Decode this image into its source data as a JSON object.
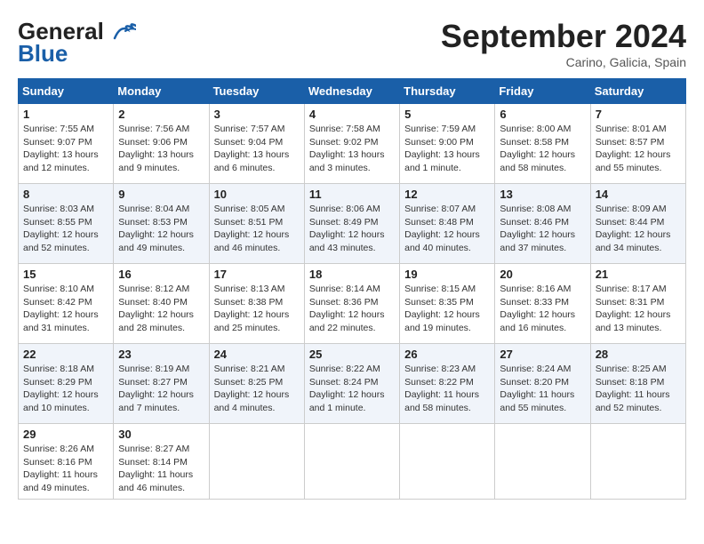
{
  "logo": {
    "line1": "General",
    "line2": "Blue"
  },
  "title": "September 2024",
  "subtitle": "Carino, Galicia, Spain",
  "headers": [
    "Sunday",
    "Monday",
    "Tuesday",
    "Wednesday",
    "Thursday",
    "Friday",
    "Saturday"
  ],
  "weeks": [
    [
      {
        "day": "1",
        "sunrise": "7:55 AM",
        "sunset": "9:07 PM",
        "daylight": "13 hours and 12 minutes."
      },
      {
        "day": "2",
        "sunrise": "7:56 AM",
        "sunset": "9:06 PM",
        "daylight": "13 hours and 9 minutes."
      },
      {
        "day": "3",
        "sunrise": "7:57 AM",
        "sunset": "9:04 PM",
        "daylight": "13 hours and 6 minutes."
      },
      {
        "day": "4",
        "sunrise": "7:58 AM",
        "sunset": "9:02 PM",
        "daylight": "13 hours and 3 minutes."
      },
      {
        "day": "5",
        "sunrise": "7:59 AM",
        "sunset": "9:00 PM",
        "daylight": "13 hours and 1 minute."
      },
      {
        "day": "6",
        "sunrise": "8:00 AM",
        "sunset": "8:58 PM",
        "daylight": "12 hours and 58 minutes."
      },
      {
        "day": "7",
        "sunrise": "8:01 AM",
        "sunset": "8:57 PM",
        "daylight": "12 hours and 55 minutes."
      }
    ],
    [
      {
        "day": "8",
        "sunrise": "8:03 AM",
        "sunset": "8:55 PM",
        "daylight": "12 hours and 52 minutes."
      },
      {
        "day": "9",
        "sunrise": "8:04 AM",
        "sunset": "8:53 PM",
        "daylight": "12 hours and 49 minutes."
      },
      {
        "day": "10",
        "sunrise": "8:05 AM",
        "sunset": "8:51 PM",
        "daylight": "12 hours and 46 minutes."
      },
      {
        "day": "11",
        "sunrise": "8:06 AM",
        "sunset": "8:49 PM",
        "daylight": "12 hours and 43 minutes."
      },
      {
        "day": "12",
        "sunrise": "8:07 AM",
        "sunset": "8:48 PM",
        "daylight": "12 hours and 40 minutes."
      },
      {
        "day": "13",
        "sunrise": "8:08 AM",
        "sunset": "8:46 PM",
        "daylight": "12 hours and 37 minutes."
      },
      {
        "day": "14",
        "sunrise": "8:09 AM",
        "sunset": "8:44 PM",
        "daylight": "12 hours and 34 minutes."
      }
    ],
    [
      {
        "day": "15",
        "sunrise": "8:10 AM",
        "sunset": "8:42 PM",
        "daylight": "12 hours and 31 minutes."
      },
      {
        "day": "16",
        "sunrise": "8:12 AM",
        "sunset": "8:40 PM",
        "daylight": "12 hours and 28 minutes."
      },
      {
        "day": "17",
        "sunrise": "8:13 AM",
        "sunset": "8:38 PM",
        "daylight": "12 hours and 25 minutes."
      },
      {
        "day": "18",
        "sunrise": "8:14 AM",
        "sunset": "8:36 PM",
        "daylight": "12 hours and 22 minutes."
      },
      {
        "day": "19",
        "sunrise": "8:15 AM",
        "sunset": "8:35 PM",
        "daylight": "12 hours and 19 minutes."
      },
      {
        "day": "20",
        "sunrise": "8:16 AM",
        "sunset": "8:33 PM",
        "daylight": "12 hours and 16 minutes."
      },
      {
        "day": "21",
        "sunrise": "8:17 AM",
        "sunset": "8:31 PM",
        "daylight": "12 hours and 13 minutes."
      }
    ],
    [
      {
        "day": "22",
        "sunrise": "8:18 AM",
        "sunset": "8:29 PM",
        "daylight": "12 hours and 10 minutes."
      },
      {
        "day": "23",
        "sunrise": "8:19 AM",
        "sunset": "8:27 PM",
        "daylight": "12 hours and 7 minutes."
      },
      {
        "day": "24",
        "sunrise": "8:21 AM",
        "sunset": "8:25 PM",
        "daylight": "12 hours and 4 minutes."
      },
      {
        "day": "25",
        "sunrise": "8:22 AM",
        "sunset": "8:24 PM",
        "daylight": "12 hours and 1 minute."
      },
      {
        "day": "26",
        "sunrise": "8:23 AM",
        "sunset": "8:22 PM",
        "daylight": "11 hours and 58 minutes."
      },
      {
        "day": "27",
        "sunrise": "8:24 AM",
        "sunset": "8:20 PM",
        "daylight": "11 hours and 55 minutes."
      },
      {
        "day": "28",
        "sunrise": "8:25 AM",
        "sunset": "8:18 PM",
        "daylight": "11 hours and 52 minutes."
      }
    ],
    [
      {
        "day": "29",
        "sunrise": "8:26 AM",
        "sunset": "8:16 PM",
        "daylight": "11 hours and 49 minutes."
      },
      {
        "day": "30",
        "sunrise": "8:27 AM",
        "sunset": "8:14 PM",
        "daylight": "11 hours and 46 minutes."
      },
      null,
      null,
      null,
      null,
      null
    ]
  ]
}
